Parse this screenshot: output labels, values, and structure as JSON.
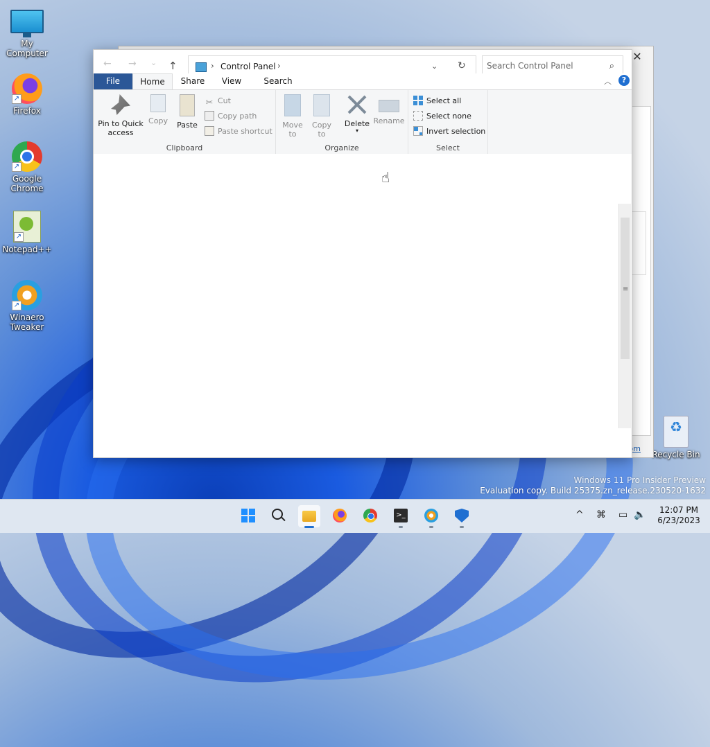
{
  "desktop": {
    "icons": [
      {
        "label": "My Computer",
        "icon": "monitor-icon"
      },
      {
        "label": "Firefox",
        "icon": "firefox-icon"
      },
      {
        "label": "Google Chrome",
        "icon": "chrome-icon"
      },
      {
        "label": "Notepad++",
        "icon": "notepadpp-icon"
      },
      {
        "label": "Winaero Tweaker",
        "icon": "winaero-icon"
      }
    ],
    "recycle_bin": "Recycle Bin",
    "watermark_line1": "Windows 11 Pro Insider Preview",
    "watermark_line2": "Evaluation copy. Build 25375.zn_release.230520-1632"
  },
  "back_window": {
    "close_glyph": "✕",
    "link_fragment": "om"
  },
  "explorer": {
    "nav": {
      "back": "←",
      "forward": "→",
      "recent": "⌄",
      "up": "↑"
    },
    "address": {
      "separator": "›",
      "crumb": "Control Panel",
      "dropdown": "⌄",
      "refresh": "↻"
    },
    "search": {
      "placeholder": "Search Control Panel",
      "value": "",
      "glyph": "⌕"
    },
    "tabs": {
      "file": "File",
      "home": "Home",
      "share": "Share",
      "view": "View",
      "search": "Search"
    },
    "ribbon_minimize": "︿",
    "help": "?",
    "ribbon": {
      "clipboard": {
        "label": "Clipboard",
        "pin": "Pin to Quick access",
        "copy": "Copy",
        "paste": "Paste",
        "cut": "Cut",
        "copy_path": "Copy path",
        "paste_shortcut": "Paste shortcut"
      },
      "organize": {
        "label": "Organize",
        "move_to": "Move to",
        "copy_to": "Copy to",
        "delete": "Delete",
        "rename": "Rename"
      },
      "select": {
        "label": "Select",
        "select_all": "Select all",
        "select_none": "Select none",
        "invert_selection": "Invert selection"
      }
    },
    "scroll_grip": "≡"
  },
  "taskbar": {
    "items": [
      "start-icon",
      "search-icon",
      "file-explorer-icon",
      "firefox-icon",
      "chrome-icon",
      "terminal-icon",
      "winaero-icon",
      "defender-icon"
    ],
    "tray": {
      "chevron": "^",
      "network": "⌘",
      "display": "▭",
      "volume": "🔈"
    },
    "time": "12:07 PM",
    "date": "6/23/2023"
  },
  "colors": {
    "file_tab": "#2b5797",
    "accent": "#1f6fd1"
  }
}
